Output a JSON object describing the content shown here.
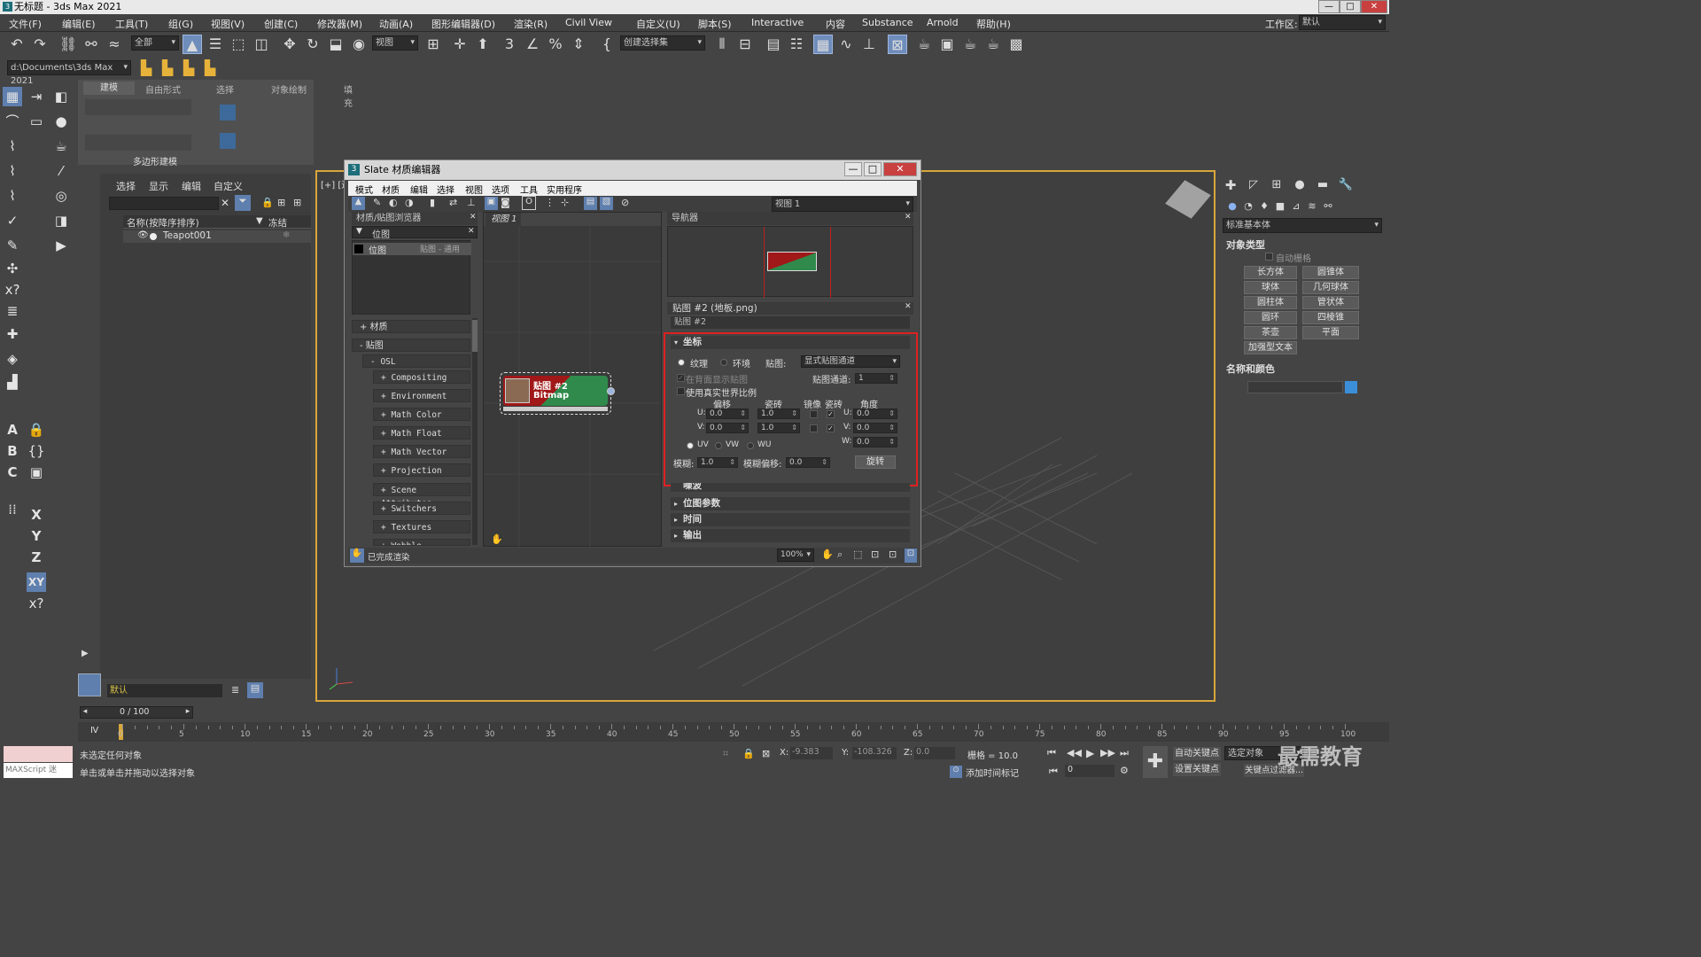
{
  "window": {
    "title": "无标题 - 3ds Max 2021",
    "minimize": "—",
    "maximize": "□",
    "close": "✕"
  },
  "menu": [
    "文件(F)",
    "编辑(E)",
    "工具(T)",
    "组(G)",
    "视图(V)",
    "创建(C)",
    "修改器(M)",
    "动画(A)",
    "图形编辑器(D)",
    "渲染(R)",
    "Civil View",
    "自定义(U)",
    "脚本(S)",
    "Interactive",
    "内容",
    "Substance",
    "Arnold",
    "帮助(H)"
  ],
  "workspace": {
    "label": "工作区:",
    "value": "默认"
  },
  "toolbar": {
    "selection_filter": "全部",
    "ref_coord": "视图",
    "named_sel": "创建选择集"
  },
  "project_path": "d:\\Documents\\3ds Max 2021",
  "ribbon": {
    "tabs": [
      "建模",
      "自由形式",
      "选择",
      "对象绘制",
      "填充"
    ],
    "panel_label": "多边形建模"
  },
  "scene_explorer": {
    "menu": [
      "选择",
      "显示",
      "编辑",
      "自定义"
    ],
    "column_name": "名称(按降序排序)",
    "column_freeze": "冻结",
    "object": "Teapot001",
    "layer": "默认"
  },
  "viewport": {
    "label": "[+] [透"
  },
  "slate": {
    "title": "Slate 材质编辑器",
    "menu": [
      "模式",
      "材质",
      "编辑",
      "选择",
      "视图",
      "选项",
      "工具",
      "实用程序"
    ],
    "view_dropdown": "视图 1",
    "browser": {
      "title": "材质/贴图浏览器",
      "search_group": "位图",
      "result_name": "位图",
      "result_type": "贴图 - 通用",
      "cat_materials": "+ 材质",
      "cat_maps": "- 贴图",
      "cat_osl": "- OSL",
      "osl_items": [
        "+ Compositing",
        "+ Environment",
        "+ Math Color",
        "+ Math Float",
        "+ Math Vector",
        "+ Projection",
        "+ Scene Attributes",
        "+ Switchers",
        "+ Textures",
        "+ Wobble"
      ]
    },
    "view_tab": "视图 1",
    "node": {
      "title": "贴图 #2",
      "subtitle": "Bitmap"
    },
    "navigator": {
      "title": "导航器"
    },
    "params": {
      "title": "贴图 #2 (地板.png)",
      "name": "贴图 #2"
    },
    "coords": {
      "header": "坐标",
      "texture": "纹理",
      "environ": "环境",
      "map_label": "贴图:",
      "map_value": "显式贴图通道",
      "show_back": "在背面显示贴图",
      "channel_label": "贴图通道:",
      "channel_value": "1",
      "real_world": "使用真实世界比例",
      "col_offset": "偏移",
      "col_tiling": "瓷砖",
      "col_mirror": "镜像",
      "col_tile": "瓷砖",
      "col_angle": "角度",
      "u_label": "U:",
      "v_label": "V:",
      "w_label": "W:",
      "u_offset": "0.0",
      "v_offset": "0.0",
      "u_tiling": "1.0",
      "v_tiling": "1.0",
      "u_angle": "0.0",
      "v_angle": "0.0",
      "w_angle": "0.0",
      "uv": "UV",
      "vw": "VW",
      "wu": "WU",
      "blur_label": "模糊:",
      "blur_value": "1.0",
      "blur_off_label": "模糊偏移:",
      "blur_off_value": "0.0",
      "rotate": "旋转"
    },
    "rollouts": [
      "噪波",
      "位图参数",
      "时间",
      "输出"
    ],
    "status": "已完成渲染",
    "zoom": "100%"
  },
  "command_panel": {
    "dropdown": "标准基本体",
    "object_type": "对象类型",
    "autogrid": "自动栅格",
    "buttons": [
      "长方体",
      "圆锥体",
      "球体",
      "几何球体",
      "圆柱体",
      "管状体",
      "圆环",
      "四棱锥",
      "茶壶",
      "平面",
      "加强型文本"
    ],
    "name_color": "名称和颜色"
  },
  "timeline": {
    "range": "0 / 100",
    "ticks": [
      "0",
      "5",
      "10",
      "15",
      "20",
      "25",
      "30",
      "35",
      "40",
      "45",
      "50",
      "55",
      "60",
      "65",
      "70",
      "75",
      "80",
      "85",
      "90",
      "95",
      "100"
    ]
  },
  "status": {
    "line1": "未选定任何对象",
    "line2": "单击或单击并拖动以选择对象",
    "maxscript": "MAXScript 迷",
    "x_label": "X:",
    "x_value": "-9.383",
    "y_label": "Y:",
    "y_value": "-108.326",
    "z_label": "Z:",
    "z_value": "0.0",
    "grid": "栅格 = 10.0",
    "add_tag": "添加时间标记",
    "auto_key": "自动关键点",
    "set_key": "设置关键点",
    "sel_obj": "选定对象",
    "key_filter": "关键点过滤器...",
    "frame": "0"
  },
  "watermark": "最需教育",
  "colors": {
    "highlight": "#e02020",
    "node_green": "#2f8a4c",
    "node_red": "#a01818",
    "select_blue": "#5f7fae"
  }
}
